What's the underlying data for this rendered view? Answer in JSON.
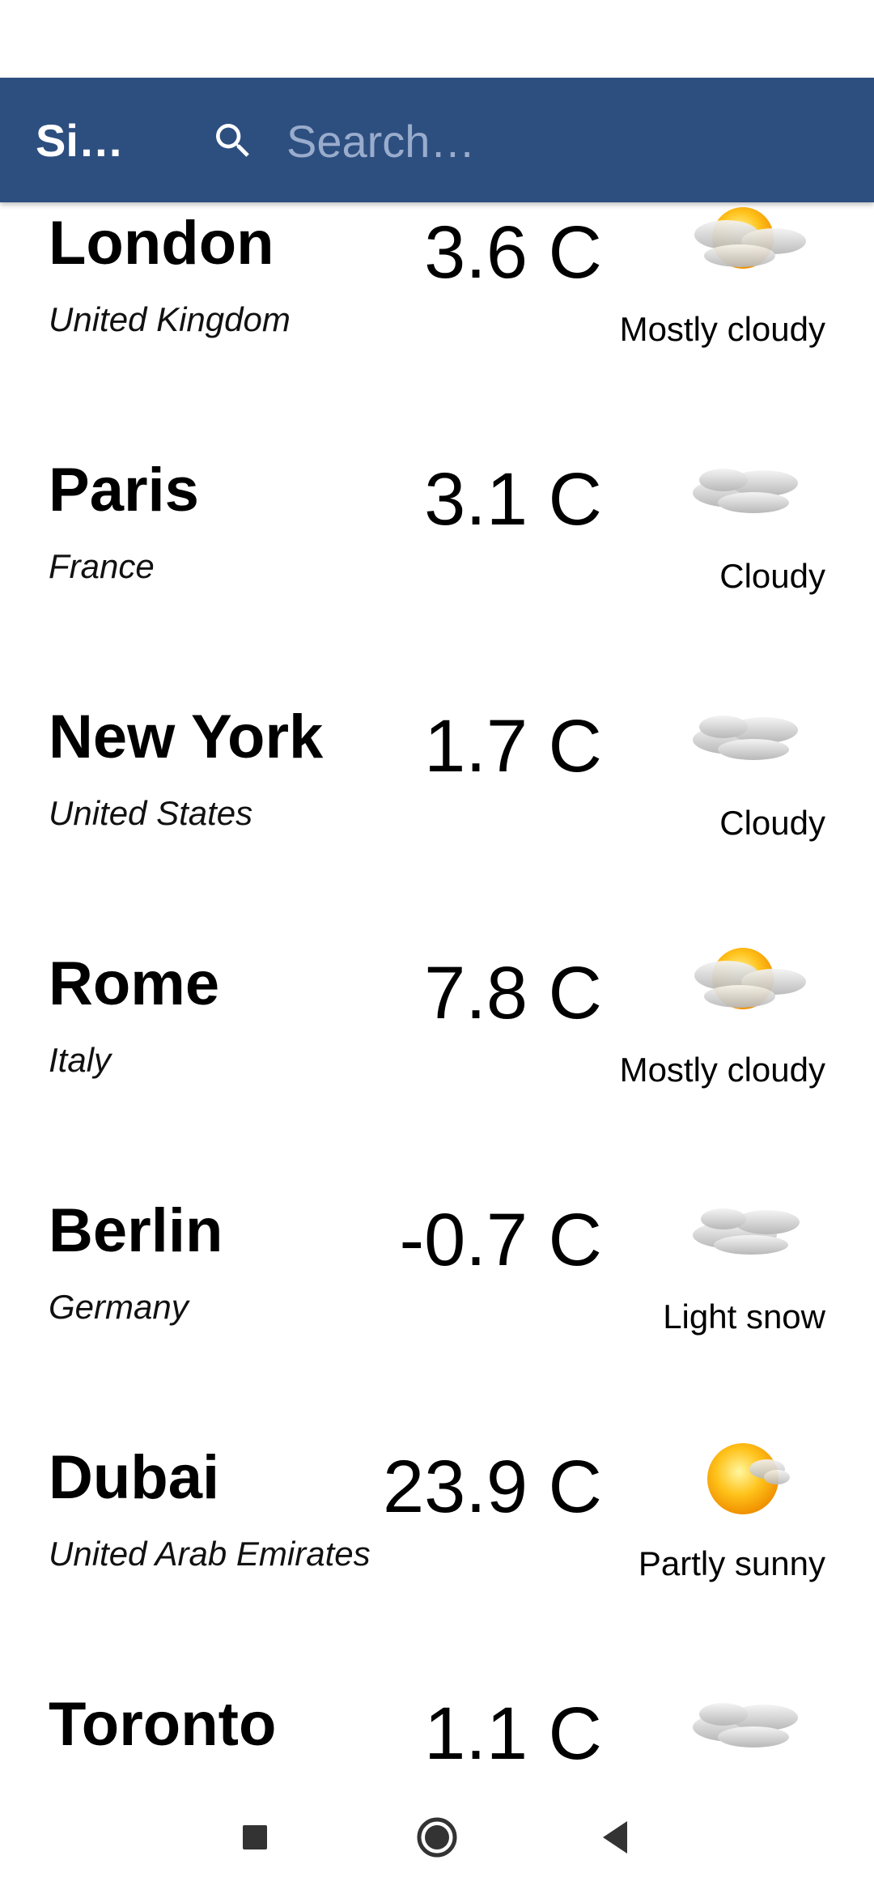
{
  "app": {
    "title": "Si…",
    "bar_color": "#2d4f80",
    "search_placeholder": "Search…"
  },
  "cities": [
    {
      "name": "London",
      "country": "United Kingdom",
      "temp": "3.6 C",
      "condition": "Mostly cloudy",
      "icon": "mostly-cloudy-icon"
    },
    {
      "name": "Paris",
      "country": "France",
      "temp": "3.1 C",
      "condition": "Cloudy",
      "icon": "cloudy-icon"
    },
    {
      "name": "New York",
      "country": "United States",
      "temp": "1.7 C",
      "condition": "Cloudy",
      "icon": "cloudy-icon"
    },
    {
      "name": "Rome",
      "country": "Italy",
      "temp": "7.8 C",
      "condition": "Mostly cloudy",
      "icon": "mostly-cloudy-icon"
    },
    {
      "name": "Berlin",
      "country": "Germany",
      "temp": "-0.7 C",
      "condition": "Light snow",
      "icon": "snow-cloud-icon"
    },
    {
      "name": "Dubai",
      "country": "United Arab Emirates",
      "temp": "23.9 C",
      "condition": "Partly sunny",
      "icon": "partly-sunny-icon"
    },
    {
      "name": "Toronto",
      "country": "",
      "temp": "1.1 C",
      "condition": "",
      "icon": "cloudy-icon"
    }
  ],
  "navigation": {
    "buttons": [
      "recents-icon",
      "home-icon",
      "back-icon"
    ]
  }
}
